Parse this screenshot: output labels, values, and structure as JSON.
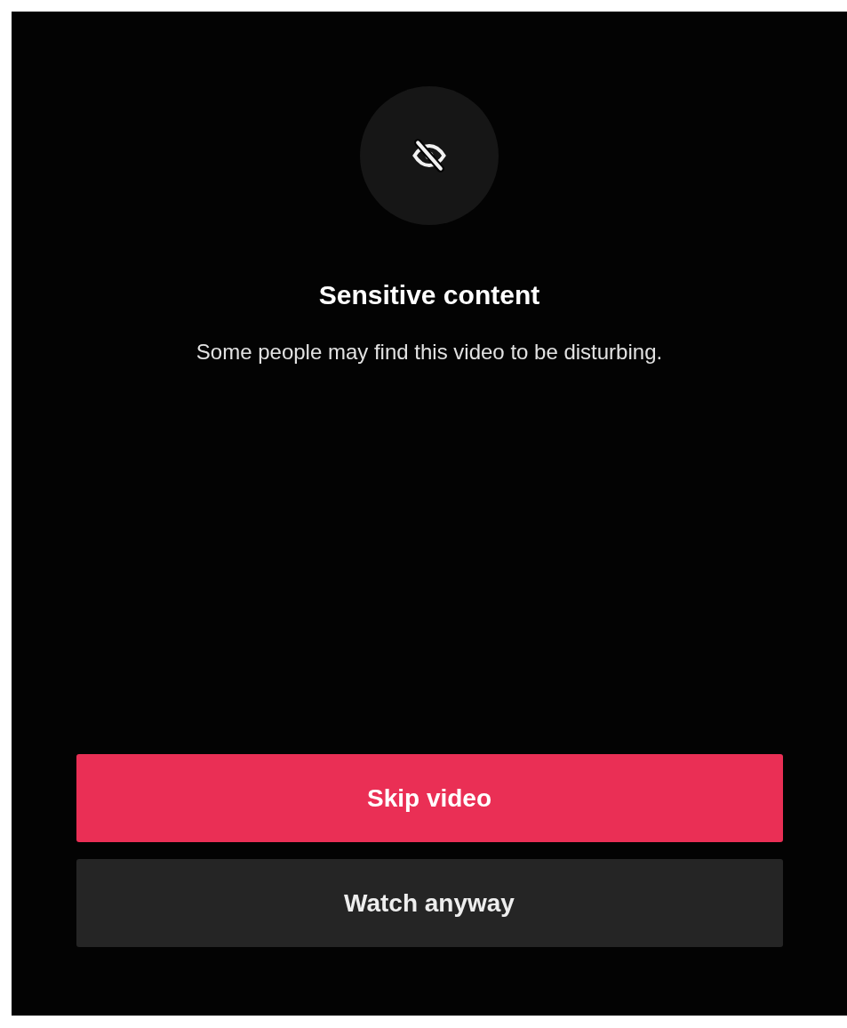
{
  "title": "Sensitive content",
  "message": "Some people may find this video to be disturbing.",
  "buttons": [
    {
      "label": "Skip video",
      "kind": "primary"
    },
    {
      "label": "Watch anyway",
      "kind": "secondary"
    }
  ]
}
